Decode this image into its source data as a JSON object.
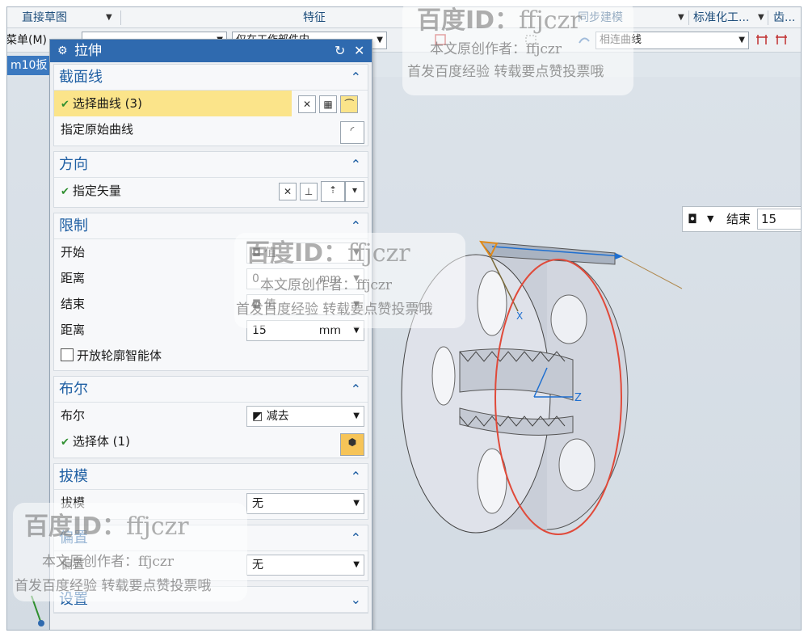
{
  "ribbon": {
    "direct_sketch": "直接草图",
    "feature": "特征",
    "sync_modeling": "同步建模",
    "standard_tools": "标准化工...",
    "gear": "齿..."
  },
  "toolbar": {
    "menu_label": "菜单(M)",
    "work_part_dropdown": "仅在工作部件内",
    "curve_rule": "相连曲线"
  },
  "tab": {
    "label": "m10扳"
  },
  "dialog": {
    "title": "拉伸",
    "section": {
      "header": "截面线",
      "select_curve": "选择曲线 (3)",
      "specify_original": "指定原始曲线"
    },
    "direction": {
      "header": "方向",
      "specify_vector": "指定矢量"
    },
    "limits": {
      "header": "限制",
      "start_label": "开始",
      "start_value": "值",
      "distance1_label": "距离",
      "distance1_value": "0",
      "distance1_unit": "mm",
      "end_label": "结束",
      "end_value": "值",
      "distance2_label": "距离",
      "distance2_value": "15",
      "distance2_unit": "mm",
      "open_profile": "开放轮廓智能体"
    },
    "boolean": {
      "header": "布尔",
      "label": "布尔",
      "value": "减去",
      "select_body": "选择体 (1)"
    },
    "draft": {
      "header": "拔模",
      "label": "拔模",
      "value": "无"
    },
    "offset": {
      "header": "偏置",
      "label": "偏置",
      "value": "无"
    },
    "settings": {
      "header": "设置"
    }
  },
  "end_overlay": {
    "label": "结束",
    "value": "15"
  },
  "axis": {
    "x": "X",
    "z": "Z"
  },
  "watermark": {
    "id_line": "百度ID：",
    "id_name": "ffjczr",
    "author_line": "本文原创作者：ffjczr",
    "notice_line": "首发百度经验 转载要点赞投票哦"
  },
  "colors": {
    "title_bar": "#2f6aaf",
    "selection": "#fbe48a",
    "accent_circle": "#e04a3a",
    "tab": "#3b79c0"
  }
}
